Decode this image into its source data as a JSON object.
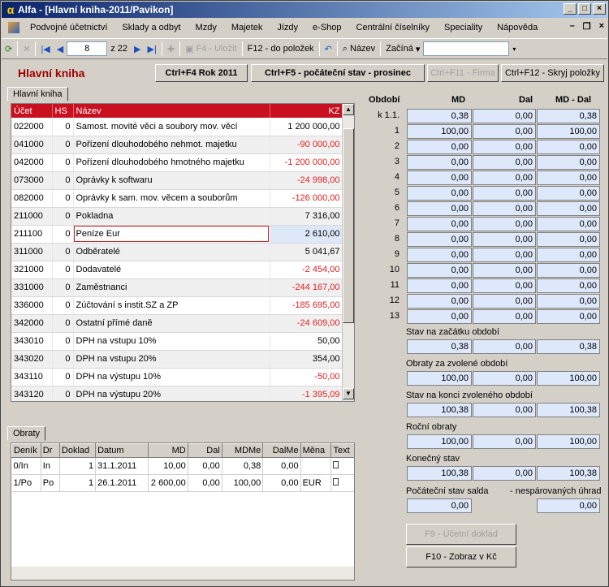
{
  "window": {
    "title": "Alfa - [Hlavní kniha-2011/Pavikon]"
  },
  "menu": [
    "Podvojné účetnictví",
    "Sklady a odbyt",
    "Mzdy",
    "Majetek",
    "Jízdy",
    "e-Shop",
    "Centrální číselníky",
    "Speciality",
    "Nápověda"
  ],
  "toolbar": {
    "page": "8",
    "page_of": "z 22",
    "save": "F4 - Uložit",
    "to_items": "F12 - do položek",
    "sort_label": "Název",
    "filter_mode": "Začíná"
  },
  "header": {
    "title": "Hlavní kniha",
    "btn_year": "Ctrl+F4 Rok 2011",
    "btn_initial": "Ctrl+F5 - počáteční stav - prosinec",
    "btn_firma": "Ctrl+F11 - Firma",
    "btn_hide": "Ctrl+F12 - Skryj položky"
  },
  "ledger": {
    "tab": "Hlavní kniha",
    "columns": [
      "Účet",
      "HS",
      "Název",
      "KZ"
    ],
    "rows": [
      [
        "022000",
        "0",
        "Samost. movité věci a soubory mov. věcí",
        "1 200 000,00"
      ],
      [
        "041000",
        "0",
        "Pořízení dlouhodobého nehmot. majetku",
        "-90 000,00"
      ],
      [
        "042000",
        "0",
        "Pořízení dlouhodobého hmotného majetku",
        "-1 200 000,00"
      ],
      [
        "073000",
        "0",
        "Oprávky k softwaru",
        "-24 998,00"
      ],
      [
        "082000",
        "0",
        "Oprávky k sam. mov. věcem a souborům",
        "-126 000,00"
      ],
      [
        "211000",
        "0",
        "Pokladna",
        "7 316,00"
      ],
      [
        "211100",
        "0",
        "Peníze Eur",
        "2 610,00"
      ],
      [
        "311000",
        "0",
        "Odběratelé",
        "5 041,67"
      ],
      [
        "321000",
        "0",
        "Dodavatelé",
        "-2 454,00"
      ],
      [
        "331000",
        "0",
        "Zaměstnanci",
        "-244 167,00"
      ],
      [
        "336000",
        "0",
        "Zúčtování s instit.SZ a ZP",
        "-185 695,00"
      ],
      [
        "342000",
        "0",
        "Ostatní přímé daně",
        "-24 609,00"
      ],
      [
        "343010",
        "0",
        "DPH na vstupu 10%",
        "50,00"
      ],
      [
        "343020",
        "0",
        "DPH na vstupu 20%",
        "354,00"
      ],
      [
        "343110",
        "0",
        "DPH na výstupu 10%",
        "-50,00"
      ],
      [
        "343120",
        "0",
        "DPH na výstupu 20%",
        "-1 395,09"
      ]
    ]
  },
  "obraty": {
    "tab": "Obraty",
    "columns": [
      "Deník",
      "Dr",
      "Doklad",
      "Datum",
      "MD",
      "Dal",
      "MDMe",
      "DalMe",
      "Měna",
      "Text"
    ],
    "rows": [
      [
        "0/In",
        "In",
        "1",
        "31.1.2011",
        "10,00",
        "0,00",
        "0,38",
        "0,00",
        "",
        ""
      ],
      [
        "1/Po",
        "Po",
        "1",
        "26.1.2011",
        "2 600,00",
        "0,00",
        "100,00",
        "0,00",
        "EUR",
        ""
      ]
    ]
  },
  "periods": {
    "headers": [
      "Období",
      "MD",
      "Dal",
      "MD - Dal"
    ],
    "rows": [
      [
        "k 1.1.",
        "0,38",
        "0,00",
        "0,38"
      ],
      [
        "1",
        "100,00",
        "0,00",
        "100,00"
      ],
      [
        "2",
        "0,00",
        "0,00",
        "0,00"
      ],
      [
        "3",
        "0,00",
        "0,00",
        "0,00"
      ],
      [
        "4",
        "0,00",
        "0,00",
        "0,00"
      ],
      [
        "5",
        "0,00",
        "0,00",
        "0,00"
      ],
      [
        "6",
        "0,00",
        "0,00",
        "0,00"
      ],
      [
        "7",
        "0,00",
        "0,00",
        "0,00"
      ],
      [
        "8",
        "0,00",
        "0,00",
        "0,00"
      ],
      [
        "9",
        "0,00",
        "0,00",
        "0,00"
      ],
      [
        "10",
        "0,00",
        "0,00",
        "0,00"
      ],
      [
        "11",
        "0,00",
        "0,00",
        "0,00"
      ],
      [
        "12",
        "0,00",
        "0,00",
        "0,00"
      ],
      [
        "13",
        "0,00",
        "0,00",
        "0,00"
      ]
    ],
    "summary": [
      {
        "label": "Stav na začátku období",
        "values": [
          "0,38",
          "0,00",
          "0,38"
        ]
      },
      {
        "label": "Obraty za zvolené období",
        "values": [
          "100,00",
          "0,00",
          "100,00"
        ]
      },
      {
        "label": "Stav na konci zvoleného období",
        "values": [
          "100,38",
          "0,00",
          "100,38"
        ]
      },
      {
        "label": "Roční obraty",
        "values": [
          "100,00",
          "0,00",
          "100,00"
        ]
      },
      {
        "label": "Konečný stav",
        "values": [
          "100,38",
          "0,00",
          "100,38"
        ]
      }
    ],
    "initial_label": "Počáteční stav salda",
    "unpaired_label": "- nespárovaných úhrad",
    "initial_value": "0,00",
    "unpaired_value": "0,00",
    "btn_doc": "F9 - Účetní doklad",
    "btn_czk": "F10 - Zobraz v Kč"
  }
}
